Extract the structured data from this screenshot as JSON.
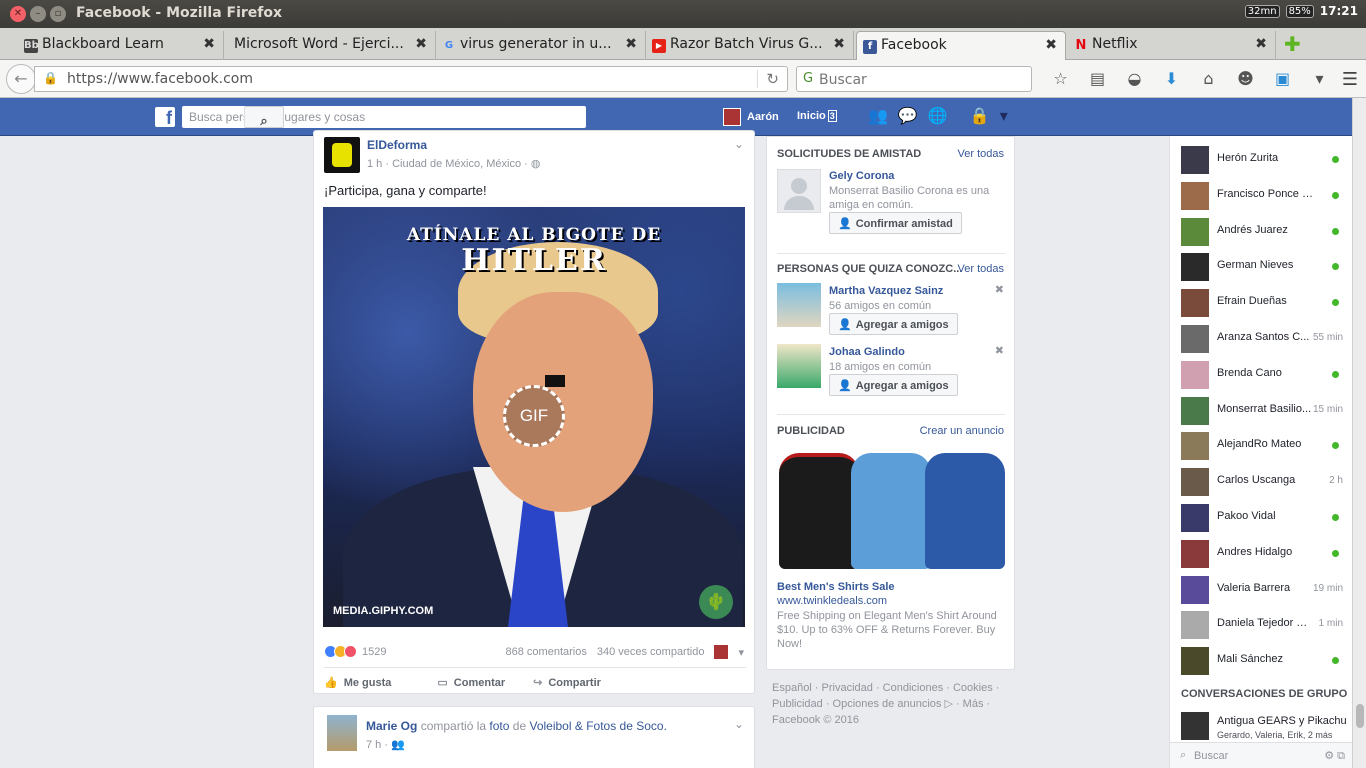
{
  "window": {
    "title": "Facebook - Mozilla Firefox"
  },
  "tray": {
    "mem": "32mn",
    "battery": "85%",
    "clock": "17:21"
  },
  "tabs": [
    {
      "label": "Blackboard Learn",
      "icon": "blackboard-icon"
    },
    {
      "label": "Microsoft Word - Ejerci...",
      "icon": "word-icon"
    },
    {
      "label": "virus generator in u...",
      "icon": "google-icon"
    },
    {
      "label": "Razor Batch Virus G...",
      "icon": "youtube-icon"
    },
    {
      "label": "Facebook",
      "icon": "facebook-icon"
    },
    {
      "label": "Netflix",
      "icon": "netflix-icon"
    }
  ],
  "nav": {
    "url": "https://www.facebook.com",
    "search_placeholder": "Buscar"
  },
  "fb": {
    "search_placeholder": "Busca personas, lugares y cosas",
    "user": "Aarón",
    "home": "Inicio",
    "home_count": "3"
  },
  "post1": {
    "author": "ElDeforma",
    "meta": "1 h · Ciudad de México, México ·",
    "text": "¡Participa, gana y comparte!",
    "gif_title_line1": "ATÍNALE AL BIGOTE DE",
    "gif_title_line2": "HITLER",
    "gif_label": "GIF",
    "gif_source": "MEDIA.GIPHY.COM",
    "reactions_count": "1529",
    "comments": "868 comentarios",
    "shares": "340 veces compartido",
    "like": "Me gusta",
    "comment": "Comentar",
    "share": "Compartir"
  },
  "post2": {
    "author": "Marie Og",
    "verb": "compartió la",
    "obj": "foto",
    "prep": "de",
    "page": "Voleibol & Fotos de Soco.",
    "meta": "7 h ·"
  },
  "right": {
    "requests_title": "SOLICITUDES DE AMISTAD",
    "see_all": "Ver todas",
    "request": {
      "name": "Gely Corona",
      "meta": "Monserrat Basilio Corona es una amiga en común.",
      "button": "Confirmar amistad"
    },
    "pymk_title": "PERSONAS QUE QUIZA CONOZC...",
    "pymk_see_all": "Ver todas",
    "pymk": [
      {
        "name": "Martha Vazquez Sainz",
        "meta": "56 amigos en común",
        "button": "Agregar a amigos"
      },
      {
        "name": "Johaa Galindo",
        "meta": "18 amigos en común",
        "button": "Agregar a amigos"
      }
    ],
    "ads_title": "PUBLICIDAD",
    "create_ad": "Crear un anuncio",
    "ad": {
      "title": "Best Men's Shirts Sale",
      "url": "www.twinkledeals.com",
      "desc": "Free Shipping on Elegant Men's Shirt Around $10. Up to 63% OFF & Returns Forever. Buy Now!"
    }
  },
  "footer": {
    "line1": "Español · Privacidad · Condiciones · Cookies ·",
    "line2": "Publicidad · Opciones de anuncios ▷ · Más ·",
    "line3": "Facebook © 2016"
  },
  "chat": {
    "contacts": [
      {
        "name": "Herón Zurita",
        "status": "online"
      },
      {
        "name": "Francisco Ponce Na...",
        "status": "online"
      },
      {
        "name": "Andrés Juarez",
        "status": "online"
      },
      {
        "name": "German Nieves",
        "status": "online"
      },
      {
        "name": "Efrain Dueñas",
        "status": "online"
      },
      {
        "name": "Aranza Santos C...",
        "time": "55 min"
      },
      {
        "name": "Brenda Cano",
        "status": "online"
      },
      {
        "name": "Monserrat Basilio...",
        "time": "15 min"
      },
      {
        "name": "AlejandRo Mateo",
        "status": "online"
      },
      {
        "name": "Carlos Uscanga",
        "time": "2 h"
      },
      {
        "name": "Pakoo Vidal",
        "status": "online"
      },
      {
        "name": "Andres Hidalgo",
        "status": "online"
      },
      {
        "name": "Valeria Barrera",
        "time": "19 min"
      },
      {
        "name": "Daniela Tejedor U...",
        "time": "1 min"
      },
      {
        "name": "Mali Sánchez",
        "status": "online"
      }
    ],
    "group_title": "CONVERSACIONES DE GRUPO",
    "group": {
      "name": "Antigua GEARS y Pikachu...",
      "members": "Gerardo, Valeria, Erik, 2 más"
    },
    "search_placeholder": "Buscar"
  },
  "colors": {
    "fb_blue": "#4267b2",
    "link": "#365899",
    "online": "#42b72a"
  }
}
